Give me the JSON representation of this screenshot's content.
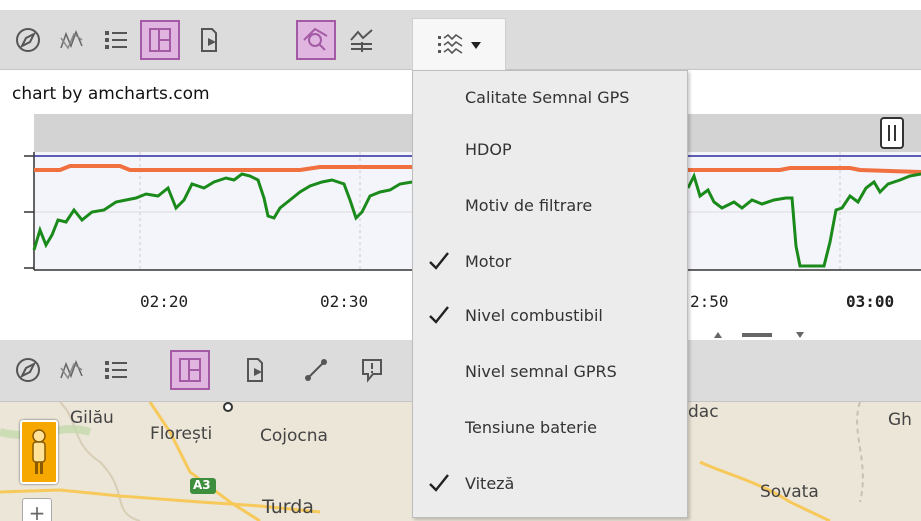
{
  "chart": {
    "credit": "chart by amcharts.com",
    "time_labels": [
      "02:20",
      "02:30",
      "2:50",
      "03:00"
    ]
  },
  "dropdown": {
    "items": [
      {
        "label": "Calitate Semnal GPS",
        "checked": false
      },
      {
        "label": "HDOP",
        "checked": false
      },
      {
        "label": "Motiv de filtrare",
        "checked": false
      },
      {
        "label": "Motor",
        "checked": true
      },
      {
        "label": "Nivel combustibil",
        "checked": true
      },
      {
        "label": "Nivel semnal GPRS",
        "checked": false
      },
      {
        "label": "Tensiune baterie",
        "checked": false
      },
      {
        "label": "Viteză",
        "checked": true
      }
    ]
  },
  "map": {
    "labels": {
      "gilau": "Gilău",
      "floresti": "Florești",
      "cojocna": "Cojocna",
      "turda": "Turda",
      "a3": "A3",
      "dac": "dac",
      "gh": "Gh",
      "sovata": "Sovata"
    }
  },
  "colors": {
    "toolbar_bg": "#dcdcdc",
    "active_btn": "#e0b6e0",
    "active_border": "#a45aa4",
    "fuel_line": "#1a8a1a",
    "motor_line": "#f07040",
    "menu_bg": "#ececec"
  }
}
